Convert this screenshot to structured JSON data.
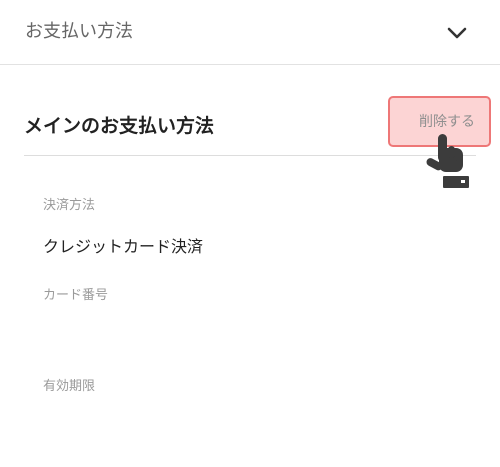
{
  "accordion": {
    "title": "お支払い方法",
    "toggle_icon": "chevron-down-icon"
  },
  "main_payment": {
    "section_title": "メインのお支払い方法",
    "delete_label": "削除する",
    "delete_button_colors": {
      "background": "#fcd4d4",
      "border": "#ee7777"
    },
    "cursor_icon": "hand-pointer-icon"
  },
  "fields": {
    "payment_method": {
      "label": "決済方法",
      "value": "クレジットカード決済"
    },
    "card_number": {
      "label": "カード番号",
      "value": ""
    },
    "expiry": {
      "label": "有効期限",
      "value": ""
    }
  }
}
